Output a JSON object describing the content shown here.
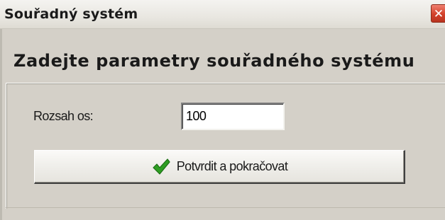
{
  "window": {
    "title": "Souřadný systém",
    "close_glyph": "✕"
  },
  "form": {
    "heading": "Zadejte parametry souřadného systému",
    "axis_range_label": "Rozsah os:",
    "axis_range_value": "100"
  },
  "actions": {
    "confirm_label": "Potvrdit a pokračovat",
    "confirm_icon": "checkmark-icon",
    "confirm_icon_color": "#2e9e22"
  }
}
